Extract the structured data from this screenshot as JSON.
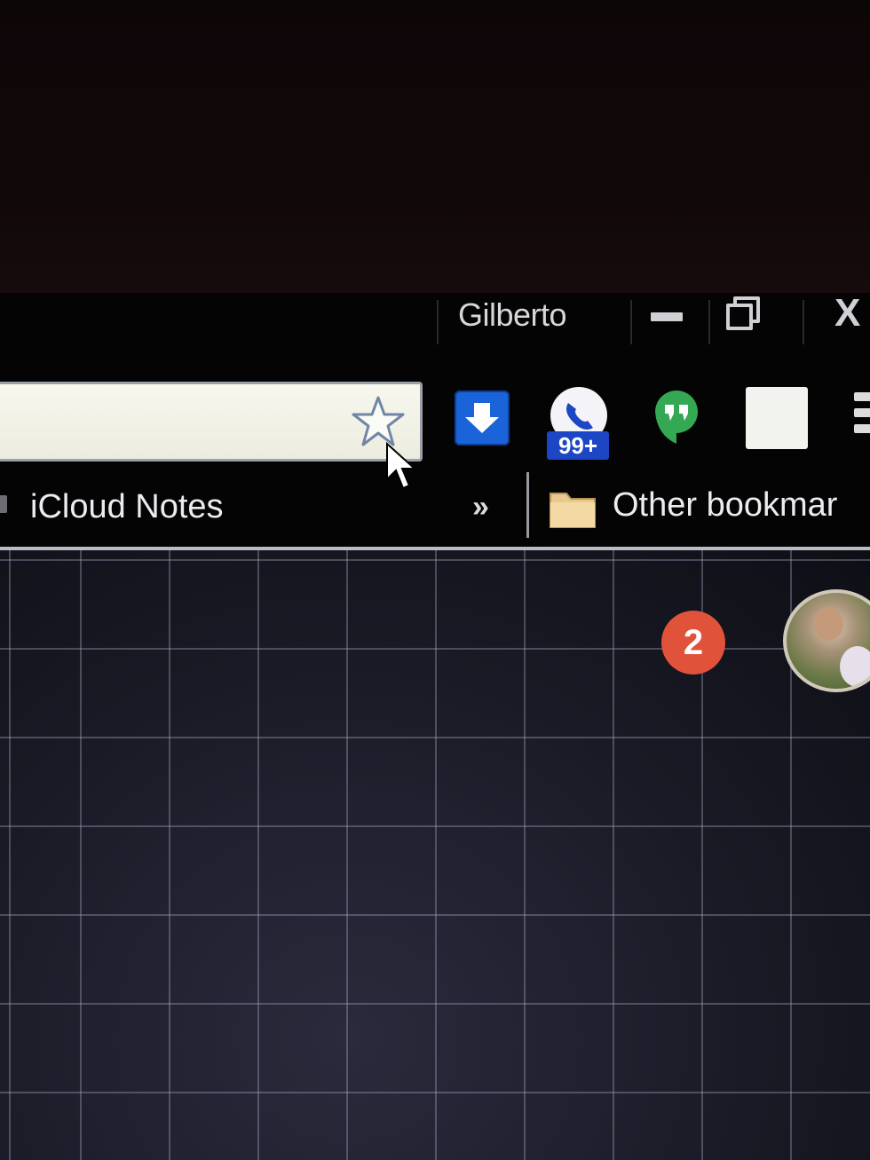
{
  "titlebar": {
    "profile_name": "Gilberto",
    "minimize_icon": "minimize-icon",
    "restore_icon": "restore-icon",
    "close_label": "X"
  },
  "toolbar": {
    "omnibox_value": "",
    "bookmark_star_icon": "star-outline-icon",
    "extensions": [
      {
        "name": "download-extension",
        "icon": "download-arrow-icon",
        "color": "#1a63d8"
      },
      {
        "name": "call-extension",
        "icon": "phone-icon",
        "badge": "99+",
        "badge_color": "#1c46c4"
      },
      {
        "name": "hangouts-extension",
        "icon": "hangouts-icon",
        "color": "#34a853"
      },
      {
        "name": "blank-extension",
        "icon": "blank-icon"
      }
    ],
    "menu_icon": "hamburger-menu-icon"
  },
  "bookmarks": {
    "items": [
      {
        "label": "iCloud Notes"
      }
    ],
    "overflow_label": "»",
    "other_label": "Other bookmar"
  },
  "content": {
    "notification_count": "2",
    "notification_color": "#e0533a",
    "avatar": "profile-avatar"
  }
}
